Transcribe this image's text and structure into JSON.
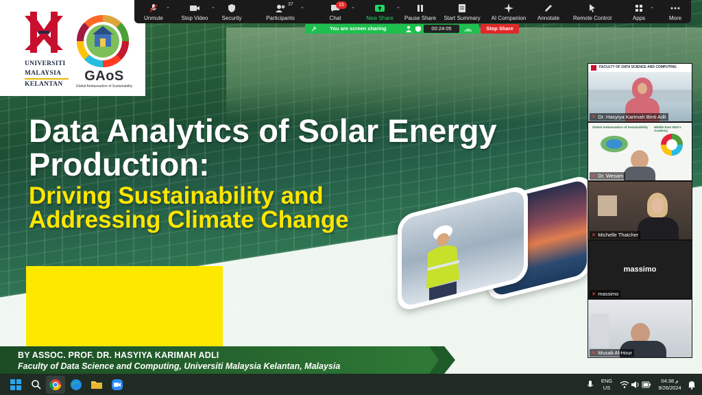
{
  "slide": {
    "university": [
      "UNIVERSITI",
      "MALAYSIA",
      "KELANTAN"
    ],
    "gaos_title": "GAoS",
    "gaos_subtitle": "Global Ambassadors of Sustainability",
    "title": "Data Analytics of Solar Energy\nProduction:",
    "subtitle": "Driving Sustainability and\nAddressing Climate Change",
    "author": "BY ASSOC. PROF. DR. HASYIYA KARIMAH ADLI",
    "affiliation": "Faculty of Data Science and Computing, Universiti Malaysia Kelantan, Malaysia"
  },
  "toolbar": {
    "unmute": "Unmute",
    "stop_video": "Stop Video",
    "security": "Security",
    "participants": "Participants",
    "participants_count": "37",
    "chat": "Chat",
    "chat_badge": "15",
    "new_share": "New Share",
    "pause_share": "Pause Share",
    "start_summary": "Start Summary",
    "ai_companion": "AI Companion",
    "annotate": "Annotate",
    "remote_control": "Remote Control",
    "apps": "Apps",
    "more": "More"
  },
  "share_status": {
    "message": "You are screen sharing",
    "timer": "00:24:05",
    "stop_label": "Stop Share"
  },
  "participants": [
    {
      "name": "Dr. Hasyiya Karimah Binti Adli",
      "slide_header": "FACULTY OF DATA SCIENCE AND COMPUTING"
    },
    {
      "name": "Dr. Wesam",
      "header_left": "Global Ambassadors of Sustainability",
      "header_right": "Middle East SDG's Academy"
    },
    {
      "name": "Michelle Thatcher"
    },
    {
      "name": "massimo",
      "display": "massimo"
    },
    {
      "name": "Musab Al-Hour"
    }
  ],
  "taskbar": {
    "language": "ENG",
    "region": "US",
    "time": "04:38 م",
    "date": "9/26/2024"
  },
  "colors": {
    "accent_yellow": "#ffe600",
    "zoom_green": "#1fbf4f",
    "stop_red": "#e02828",
    "credit_green": "#1f5a2a"
  }
}
